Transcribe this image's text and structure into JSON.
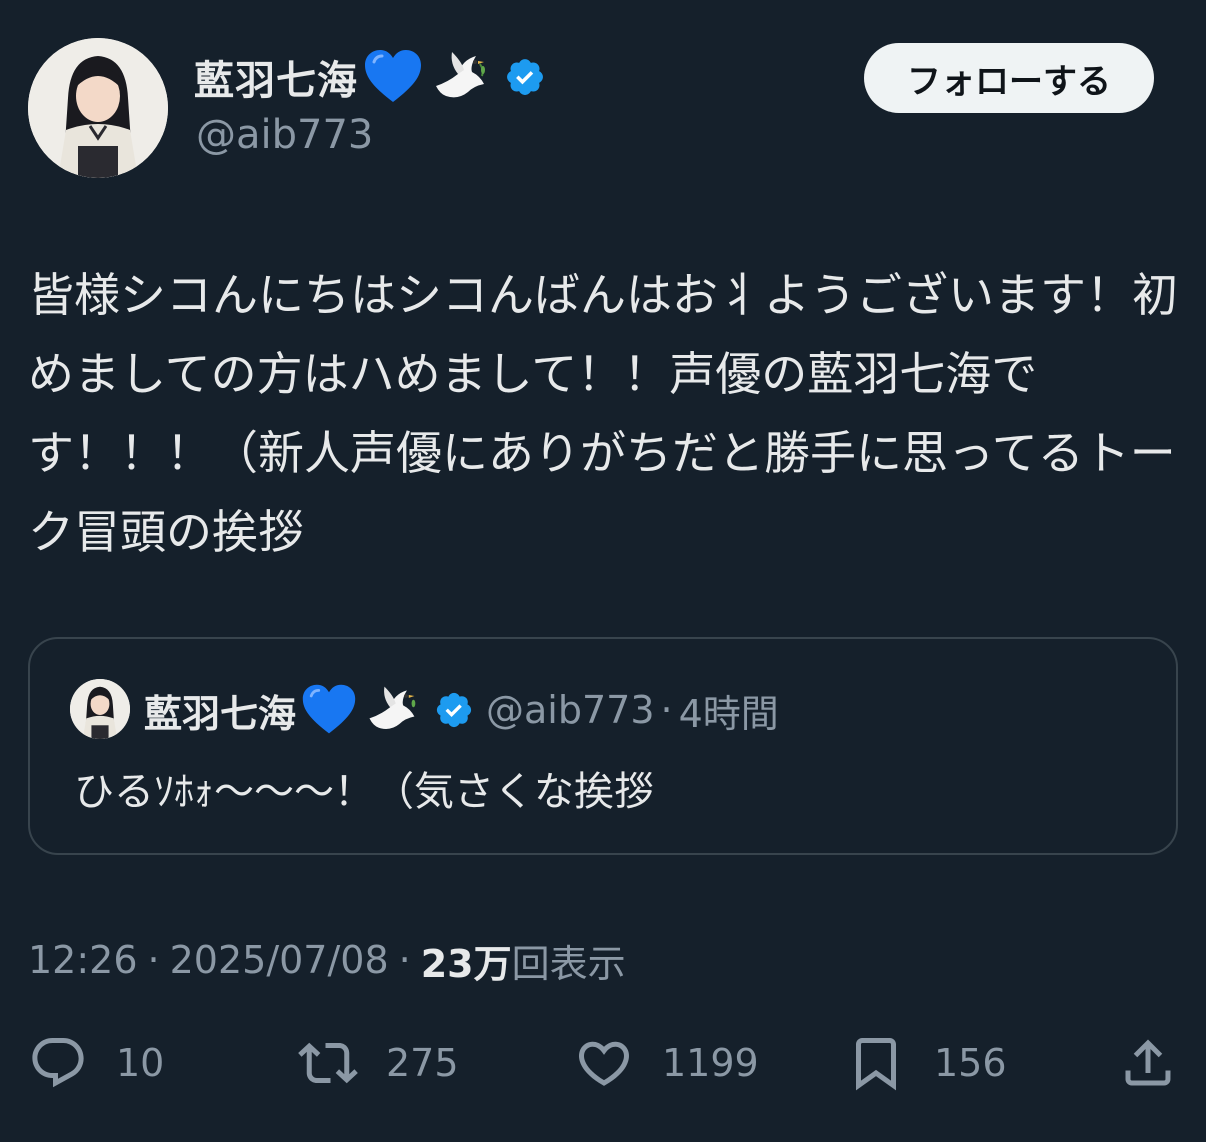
{
  "author": {
    "name": "藍羽七海",
    "handle": "@aib773",
    "emoji_names": [
      "blue-heart-icon",
      "dove-icon"
    ]
  },
  "follow_button": "フォローする",
  "tweet": {
    "text": "皆様シコんにちはシコんばんはお⺦ようございます！初めましての方はハめまして！！声優の藍羽七海です！！！（新人声優にありがちだと勝手に思ってるトーク冒頭の挨拶"
  },
  "quote": {
    "name": "藍羽七海",
    "handle": "@aib773",
    "time": "4時間",
    "text": "ひるｿﾎｫ〜〜〜！（気さくな挨拶"
  },
  "meta": {
    "time": "12:26",
    "date": "2025/07/08",
    "views_count": "23万",
    "views_label": "回表示"
  },
  "actions": {
    "replies": "10",
    "retweets": "275",
    "likes": "1199",
    "bookmarks": "156"
  },
  "colors": {
    "background": "#15202b",
    "text": "#e7e9ea",
    "secondary": "#8b98a5",
    "verified": "#1d9bf0",
    "heart": "#1877f2"
  }
}
